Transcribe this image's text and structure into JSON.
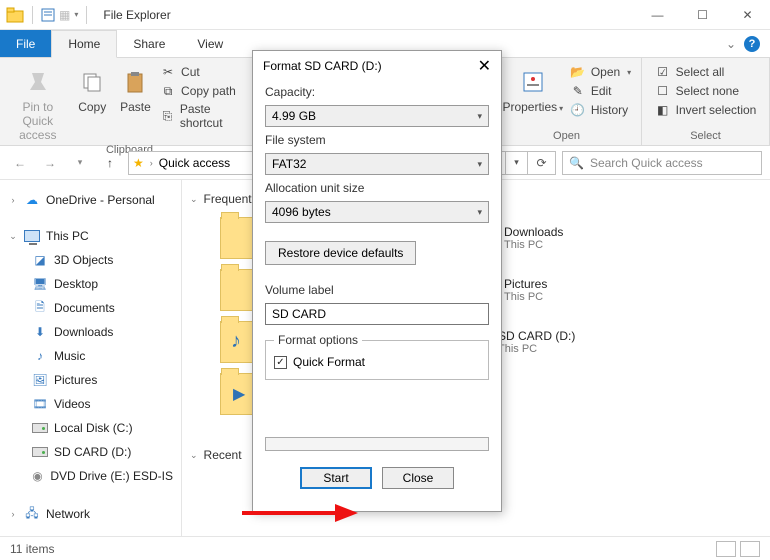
{
  "titlebar": {
    "title": "File Explorer"
  },
  "tabs": {
    "file": "File",
    "home": "Home",
    "share": "Share",
    "view": "View"
  },
  "ribbon": {
    "clipboard": {
      "label": "Clipboard",
      "pin": "Pin to Quick\naccess",
      "copy": "Copy",
      "paste": "Paste",
      "cut": "Cut",
      "copypath": "Copy path",
      "pasteshortcut": "Paste shortcut"
    },
    "open": {
      "label": "Open",
      "properties": "Properties",
      "open": "Open",
      "edit": "Edit",
      "history": "History"
    },
    "select": {
      "label": "Select",
      "all": "Select all",
      "none": "Select none",
      "invert": "Invert selection"
    }
  },
  "address": {
    "location": "Quick access",
    "search_placeholder": "Search Quick access"
  },
  "nav": {
    "onedrive": "OneDrive - Personal",
    "thispc": "This PC",
    "items": [
      "3D Objects",
      "Desktop",
      "Documents",
      "Downloads",
      "Music",
      "Pictures",
      "Videos",
      "Local Disk (C:)",
      "SD CARD (D:)",
      "DVD Drive (E:) ESD-IS"
    ],
    "network": "Network"
  },
  "content": {
    "group1": "Frequent folders",
    "group2_prefix": "Recent",
    "items": [
      {
        "name": "Downloads",
        "loc": "This PC"
      },
      {
        "name": "Pictures",
        "loc": "This PC"
      },
      {
        "name": "SD CARD (D:)",
        "loc": "This PC"
      }
    ]
  },
  "status": {
    "count": "11 items"
  },
  "dialog": {
    "title": "Format SD CARD (D:)",
    "capacity_lbl": "Capacity:",
    "capacity": "4.99 GB",
    "fs_lbl": "File system",
    "fs": "FAT32",
    "alloc_lbl": "Allocation unit size",
    "alloc": "4096 bytes",
    "restore": "Restore device defaults",
    "vol_lbl": "Volume label",
    "vol": "SD CARD",
    "opts_lbl": "Format options",
    "quick": "Quick Format",
    "start": "Start",
    "close": "Close"
  }
}
